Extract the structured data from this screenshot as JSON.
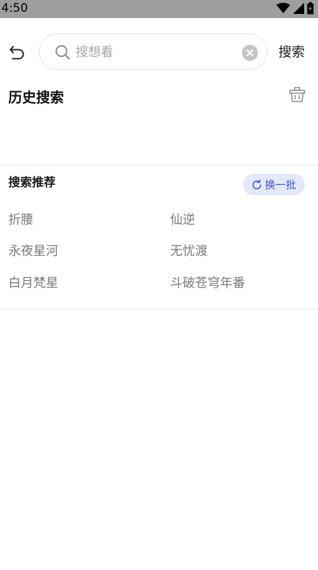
{
  "status_bar": {
    "time": "4:50",
    "icons": [
      "wifi-icon",
      "signal-icon",
      "battery-icon"
    ]
  },
  "search": {
    "placeholder": "搜想看",
    "value": "",
    "submit_label": "搜索"
  },
  "history": {
    "title": "历史搜索",
    "items": []
  },
  "recommend": {
    "title": "搜索推荐",
    "refresh_label": "换一批",
    "items": [
      "折腰",
      "仙逆",
      "永夜星河",
      "无忧渡",
      "白月梵星",
      "斗破苍穹年番"
    ]
  },
  "colors": {
    "accent": "#3d55c8",
    "accent_bg": "#e4e8fb",
    "status_bar_bg": "#9e9e9e",
    "muted_text": "#7a7a7a"
  }
}
